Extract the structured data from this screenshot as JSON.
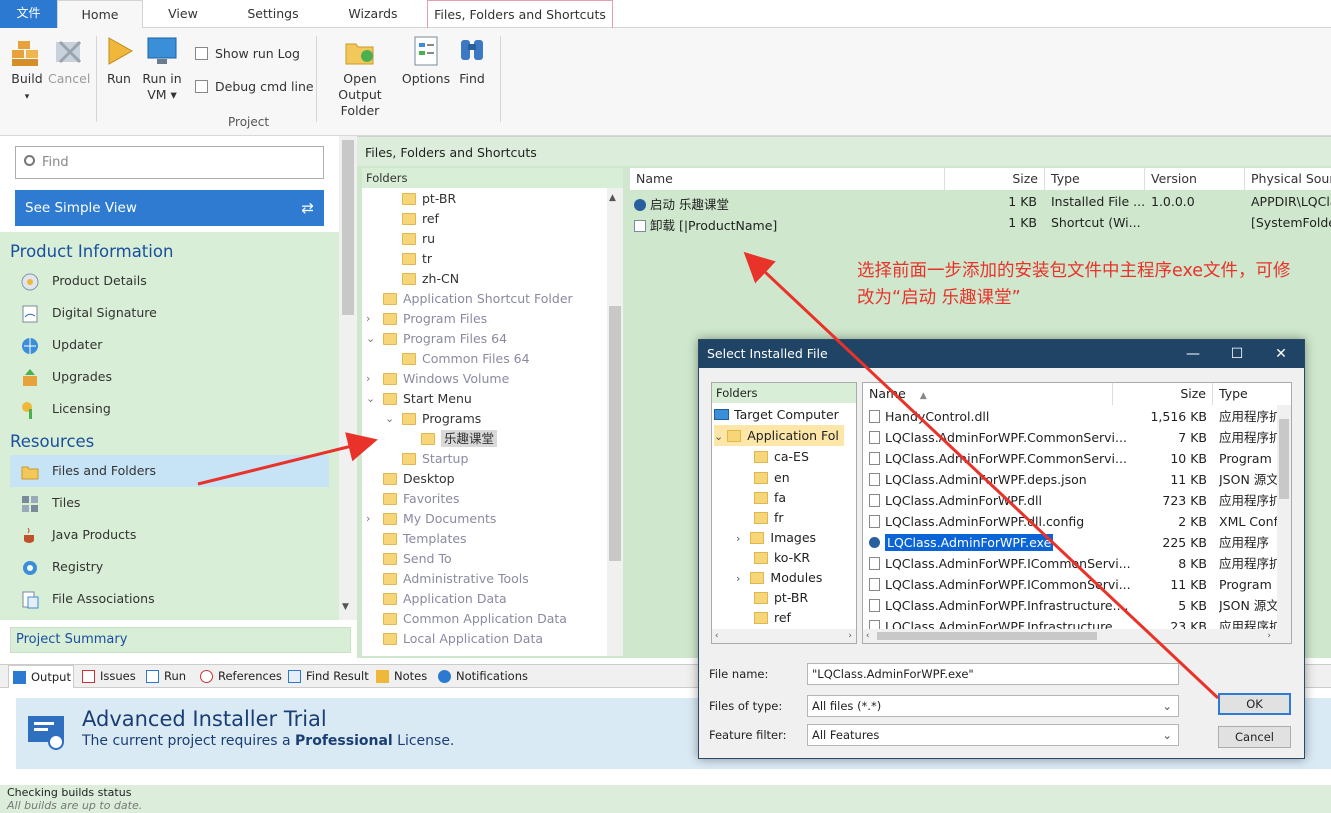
{
  "ribbon_tabs": {
    "file": "文件",
    "home": "Home",
    "view": "View",
    "settings": "Settings",
    "wizards": "Wizards",
    "context": "Files, Folders and Shortcuts"
  },
  "ribbon": {
    "build": "Build",
    "cancel": "Cancel",
    "run": "Run",
    "run_vm_1": "Run in",
    "run_vm_2": "VM",
    "show_run_log": "Show run Log",
    "debug_cmd": "Debug cmd line",
    "open_output_1": "Open Output",
    "open_output_2": "Folder",
    "options": "Options",
    "find": "Find",
    "group_project": "Project"
  },
  "left": {
    "find_placeholder": "Find",
    "simple_view": "See Simple View",
    "product_info_header": "Product Information",
    "product_items": [
      "Product Details",
      "Digital Signature",
      "Updater",
      "Upgrades",
      "Licensing"
    ],
    "resources_header": "Resources",
    "resource_items": [
      "Files and Folders",
      "Tiles",
      "Java Products",
      "Registry",
      "File Associations"
    ],
    "project_summary": "Project Summary"
  },
  "main": {
    "title": "Files, Folders and Shortcuts",
    "folders_header": "Folders",
    "tree": [
      "pt-BR",
      "ref",
      "ru",
      "tr",
      "zh-CN",
      "Application Shortcut Folder",
      "Program Files",
      "Program Files 64",
      "Common Files 64",
      "Windows Volume",
      "Start Menu",
      "Programs",
      "乐趣课堂",
      "Startup",
      "Desktop",
      "Favorites",
      "My Documents",
      "Templates",
      "Send To",
      "Administrative Tools",
      "Application Data",
      "Common Application Data",
      "Local Application Data"
    ],
    "columns": [
      "Name",
      "Size",
      "Type",
      "Version",
      "Physical Sourc"
    ],
    "files": [
      {
        "name": "启动 乐趣课堂",
        "size": "1 KB",
        "type": "Installed File ...",
        "version": "1.0.0.0",
        "source": "APPDIR\\LQCla"
      },
      {
        "name": "卸载 [|ProductName]",
        "size": "1 KB",
        "type": "Shortcut (Wi...",
        "version": "",
        "source": "[SystemFolder"
      }
    ],
    "annotation": "选择前面一步添加的安装包文件中主程序exe文件，可修改为“启动 乐趣课堂”"
  },
  "dialog": {
    "title": "Select Installed File",
    "folders_header": "Folders",
    "tree": [
      "Target Computer",
      "Application Fol",
      "ca-ES",
      "en",
      "fa",
      "fr",
      "Images",
      "ko-KR",
      "Modules",
      "pt-BR",
      "ref"
    ],
    "columns": [
      "Name",
      "Size",
      "Type"
    ],
    "files": [
      {
        "name": "HandyControl.dll",
        "size": "1,516 KB",
        "type": "应用程序扩"
      },
      {
        "name": "LQClass.AdminForWPF.CommonServi...",
        "size": "7 KB",
        "type": "应用程序扩"
      },
      {
        "name": "LQClass.AdminForWPF.CommonServi...",
        "size": "10 KB",
        "type": "Program"
      },
      {
        "name": "LQClass.AdminForWPF.deps.json",
        "size": "11 KB",
        "type": "JSON 源文"
      },
      {
        "name": "LQClass.AdminForWPF.dll",
        "size": "723 KB",
        "type": "应用程序扩"
      },
      {
        "name": "LQClass.AdminForWPF.dll.config",
        "size": "2 KB",
        "type": "XML Conf"
      },
      {
        "name": "LQClass.AdminForWPF.exe",
        "size": "225 KB",
        "type": "应用程序"
      },
      {
        "name": "LQClass.AdminForWPF.ICommonServi...",
        "size": "8 KB",
        "type": "应用程序扩"
      },
      {
        "name": "LQClass.AdminForWPF.ICommonServi...",
        "size": "11 KB",
        "type": "Program"
      },
      {
        "name": "LQClass.AdminForWPF.Infrastructure....",
        "size": "5 KB",
        "type": "JSON 源文"
      },
      {
        "name": "LQClass.AdminForWPF.Infrastructure....",
        "size": "23 KB",
        "type": "应用程序扩"
      }
    ],
    "file_name_label": "File name:",
    "file_name_value": "\"LQClass.AdminForWPF.exe\"",
    "file_type_label": "Files of type:",
    "file_type_value": "All files (*.*)",
    "filter_label": "Feature filter:",
    "filter_value": "All Features",
    "ok": "OK",
    "cancel": "Cancel"
  },
  "bottom_tabs": [
    "Output",
    "Issues",
    "Run",
    "References",
    "Find Result",
    "Notes",
    "Notifications"
  ],
  "trial": {
    "title": "Advanced Installer Trial",
    "sub_pre": "The current project requires a ",
    "sub_bold": "Professional",
    "sub_post": " License."
  },
  "status": {
    "line1": "Checking builds status",
    "line2": "All builds are up to date."
  },
  "colors": {
    "accent": "#2e7bd1",
    "green_panel": "#d8eed6",
    "annotation": "#e8322a",
    "dialog_title": "#1f4466"
  }
}
